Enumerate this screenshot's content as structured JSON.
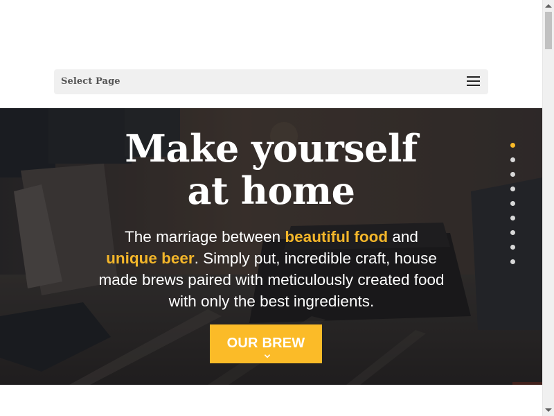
{
  "menu": {
    "label": "Select Page",
    "icon": "hamburger-icon"
  },
  "hero": {
    "title_line1": "Make yourself",
    "title_line2": "at home",
    "text_part1": "The marriage between ",
    "text_highlight1": "beautiful food",
    "text_part2": " and ",
    "text_highlight2": "unique beer",
    "text_part3": ". Simply put, incredible craft, house made brews paired with meticulously created food with only the best ingredients.",
    "cta_label": "OUR BREW",
    "cta_icon": "chevron-down-icon"
  },
  "slider": {
    "dot_count": 9,
    "active_index": 0
  },
  "colors": {
    "accent": "#fbbb28",
    "highlight": "#f3b62a",
    "menu_bg": "#f0f0f0"
  }
}
